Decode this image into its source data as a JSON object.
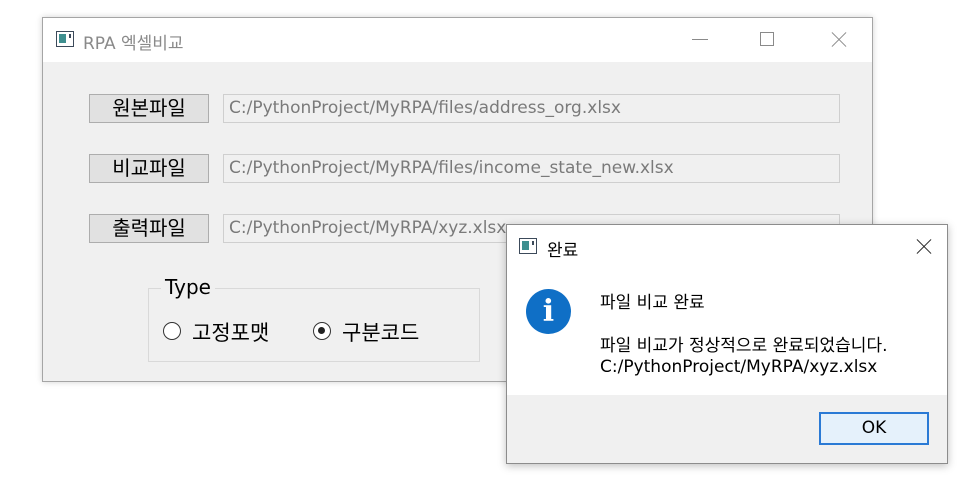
{
  "main_window": {
    "title": "RPA 엑셀비교",
    "rows": [
      {
        "button": "원본파일",
        "path": "C:/PythonProject/MyRPA/files/address_org.xlsx"
      },
      {
        "button": "비교파일",
        "path": "C:/PythonProject/MyRPA/files/income_state_new.xlsx"
      },
      {
        "button": "출력파일",
        "path": "C:/PythonProject/MyRPA/xyz.xlsx"
      }
    ],
    "type_group": {
      "title": "Type",
      "options": [
        {
          "label": "고정포맷",
          "selected": false
        },
        {
          "label": "구분코드",
          "selected": true
        }
      ]
    }
  },
  "dialog": {
    "title": "완료",
    "heading": "파일 비교 완료",
    "message_line1": "파일 비교가 정상적으로 완료되었습니다.",
    "message_line2": "C:/PythonProject/MyRPA/xyz.xlsx",
    "ok_label": "OK",
    "icon": "info-icon"
  }
}
